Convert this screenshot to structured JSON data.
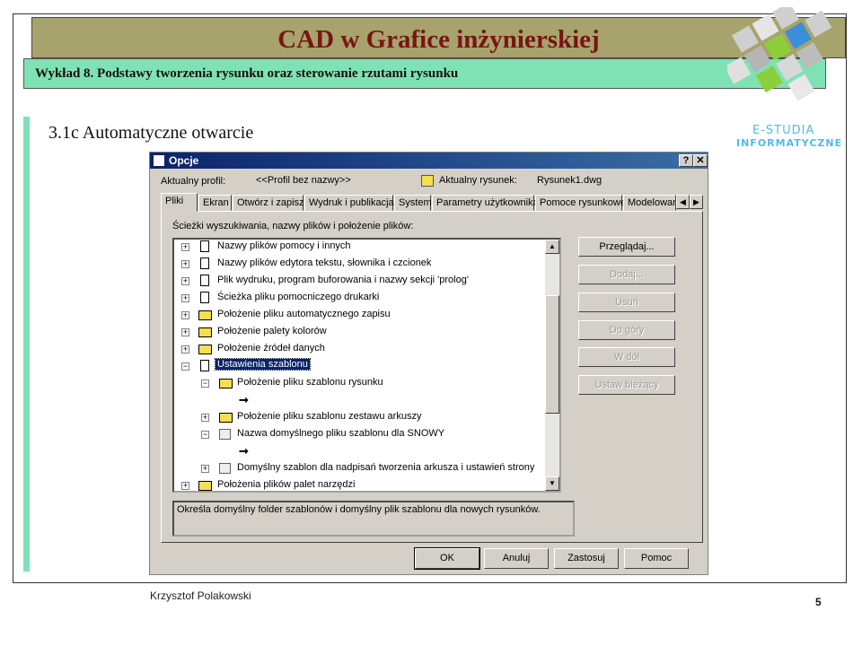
{
  "slide": {
    "title": "CAD w Grafice inżynierskiej",
    "subtitle": "Wykład 8.  Podstawy tworzenia rysunku oraz sterowanie rzutami rysunku",
    "section_heading": "3.1c Automatyczne otwarcie",
    "author": "Krzysztof Polakowski",
    "page_number": "5",
    "logo_line1": "E-STUDIA",
    "logo_line2": "INFORMATYCZNE"
  },
  "dialog": {
    "title": "Opcje",
    "help_btn": "?",
    "close_btn": "✕",
    "profile_label": "Aktualny profil:",
    "profile_value": "<<Profil bez nazwy>>",
    "drawing_label": "Aktualny rysunek:",
    "drawing_value": "Rysunek1.dwg",
    "tabs": [
      "Pliki",
      "Ekran",
      "Otwórz i zapisz",
      "Wydruk i publikacja",
      "System",
      "Parametry użytkownika",
      "Pomoce rysunkowe",
      "Modelowan"
    ],
    "panel_label": "Ścieżki wyszukiwania, nazwy plików i położenie plików:",
    "tree": [
      "Nazwy plików pomocy i innych",
      "Nazwy plików edytora tekstu, słownika i czcionek",
      "Plik wydruku, program buforowania i nazwy sekcji 'prolog'",
      "Ścieżka pliku pomocniczego drukarki",
      "Położenie pliku automatycznego zapisu",
      "Położenie palety kolorów",
      "Położenie źródeł danych",
      "Ustawienia szablonu",
      "Położenie pliku szablonu rysunku",
      "Położenie pliku szablonu zestawu arkuszy",
      "Nazwa domyślnego pliku szablonu dla SNOWY",
      "Domyślny szablon dla nadpisań tworzenia arkusza i ustawień strony",
      "Położenia plików palet narzędzi"
    ],
    "side_buttons": [
      "Przeglądaj...",
      "Dodaj...",
      "Usuń",
      "Do góry",
      "W dół",
      "Ustaw bieżący"
    ],
    "description": "Określa domyślny folder szablonów i domyślny plik szablonu dla nowych rysunków.",
    "buttons": {
      "ok": "OK",
      "cancel": "Anuluj",
      "apply": "Zastosuj",
      "help": "Pomoc"
    }
  }
}
